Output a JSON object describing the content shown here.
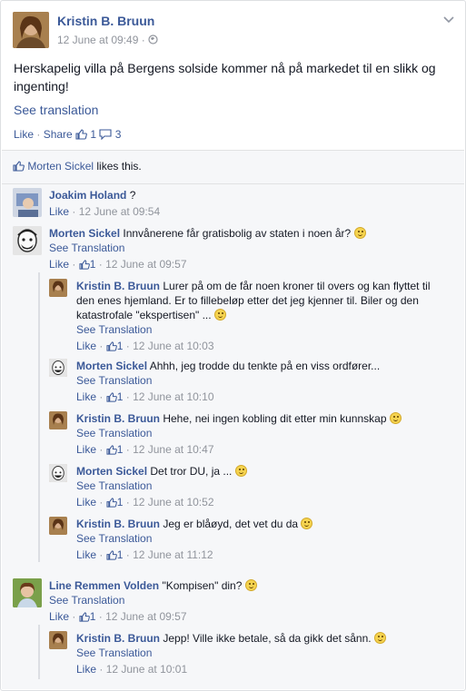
{
  "post": {
    "author": "Kristin B. Bruun",
    "timestamp": "12 June at 09:49",
    "meta_sep": "·",
    "text": "Herskapelig villa på Bergens solside kommer nå på markedet til en slikk og ingenting!",
    "see_translation": "See translation",
    "like_label": "Like",
    "share_label": "Share",
    "like_count": "1",
    "comment_count": "3",
    "dot": "·"
  },
  "likes": {
    "liker": "Morten Sickel",
    "suffix": "likes this."
  },
  "comments": [
    {
      "name": "Joakim Holand",
      "text": "?",
      "like": "Like",
      "likes": "",
      "time": "12 June at 09:54",
      "see_translation": ""
    },
    {
      "name": "Morten Sickel",
      "text": "Innvånerene får gratisbolig av staten i noen år?",
      "see_translation": "See Translation",
      "like": "Like",
      "likes": "1",
      "time": "12 June at 09:57"
    },
    {
      "name": "Kristin B. Bruun",
      "text": "Lurer på om de får noen kroner til overs og kan flyttet til den enes hjemland. Er to fillebeløp etter det jeg kjenner til. Biler og den katastrofale \"ekspertisen\" ...",
      "see_translation": "See Translation",
      "like": "Like",
      "likes": "1",
      "time": "12 June at 10:03"
    },
    {
      "name": "Morten Sickel",
      "text": "Ahhh, jeg trodde du tenkte på en viss ordfører...",
      "see_translation": "See Translation",
      "like": "Like",
      "likes": "1",
      "time": "12 June at 10:10"
    },
    {
      "name": "Kristin B. Bruun",
      "text": "Hehe, nei ingen kobling dit etter min kunnskap",
      "see_translation": "See Translation",
      "like": "Like",
      "likes": "1",
      "time": "12 June at 10:47"
    },
    {
      "name": "Morten Sickel",
      "text": "Det tror DU, ja ...",
      "see_translation": "See Translation",
      "like": "Like",
      "likes": "1",
      "time": "12 June at 10:52"
    },
    {
      "name": "Kristin B. Bruun",
      "text": "Jeg er blåøyd, det vet du da",
      "see_translation": "See Translation",
      "like": "Like",
      "likes": "1",
      "time": "12 June at 11:12"
    },
    {
      "name": "Line Remmen Volden",
      "text": "\"Kompisen\" din?",
      "see_translation": "See Translation",
      "like": "Like",
      "likes": "1",
      "time": "12 June at 09:57"
    },
    {
      "name": "Kristin B. Bruun",
      "text": "Jepp! Ville ikke betale, så da gikk det sånn.",
      "see_translation": "See Translation",
      "like": "Like",
      "likes": "",
      "time": "12 June at 10:01"
    }
  ],
  "sep": "·"
}
